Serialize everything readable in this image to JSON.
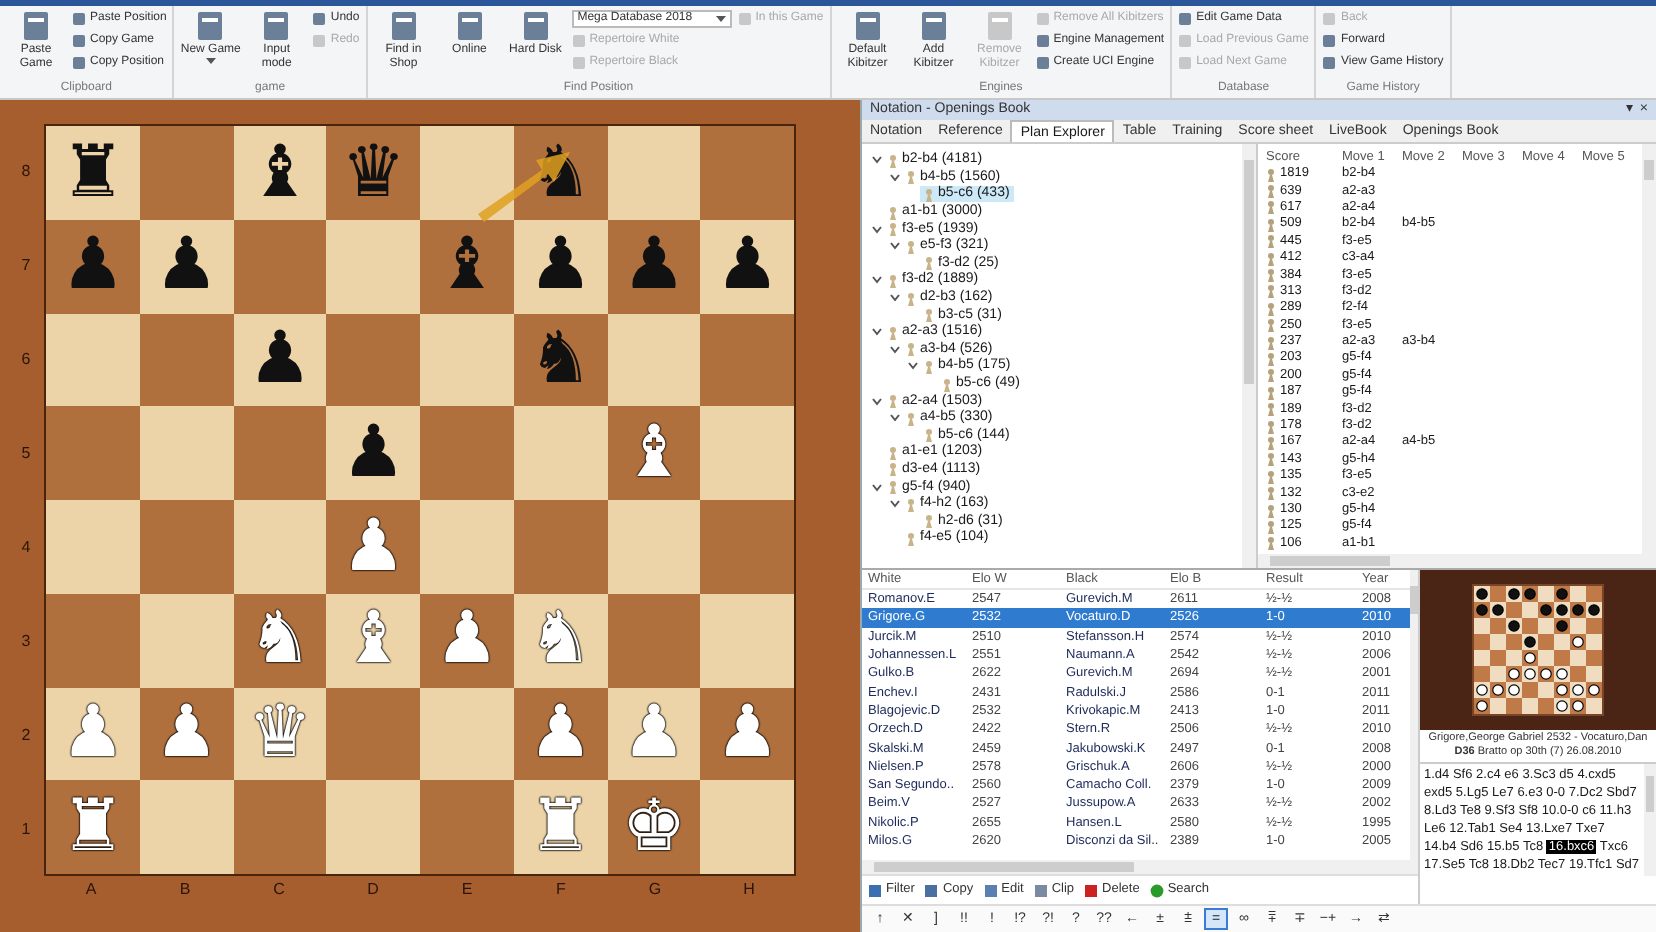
{
  "ribbon": [
    {
      "label": "Clipboard",
      "items": [
        {
          "kind": "large",
          "label": "Paste Game",
          "disabled": false
        },
        {
          "kind": "small",
          "label": "Paste Position",
          "disabled": false
        },
        {
          "kind": "small",
          "label": "Copy Game",
          "disabled": false
        },
        {
          "kind": "small",
          "label": "Copy Position",
          "disabled": false
        }
      ]
    },
    {
      "label": "game",
      "items": [
        {
          "kind": "large",
          "label": "New Game",
          "disabled": false,
          "has_menu": true
        },
        {
          "kind": "large",
          "label": "Input mode",
          "disabled": false
        },
        {
          "kind": "small",
          "label": "Undo",
          "disabled": false
        },
        {
          "kind": "small",
          "label": "Redo",
          "disabled": true
        }
      ]
    },
    {
      "label": "Find Position",
      "items": [
        {
          "kind": "large",
          "label": "Find in Shop",
          "disabled": false
        },
        {
          "kind": "large",
          "label": "Online",
          "disabled": false
        },
        {
          "kind": "large",
          "label": "Hard Disk",
          "disabled": false
        },
        {
          "kind": "dropdown",
          "label": "Mega Database 2018",
          "disabled": false
        },
        {
          "kind": "small",
          "label": "Repertoire White",
          "disabled": true
        },
        {
          "kind": "small",
          "label": "Repertoire Black",
          "disabled": true
        },
        {
          "kind": "small",
          "label": "In this Game",
          "disabled": true
        }
      ]
    },
    {
      "label": "Engines",
      "items": [
        {
          "kind": "large",
          "label": "Default Kibitzer",
          "disabled": false
        },
        {
          "kind": "large",
          "label": "Add Kibitzer",
          "disabled": false
        },
        {
          "kind": "large",
          "label": "Remove Kibitzer",
          "disabled": true
        },
        {
          "kind": "small",
          "label": "Remove All Kibitzers",
          "disabled": true
        },
        {
          "kind": "small",
          "label": "Engine Management",
          "disabled": false
        },
        {
          "kind": "small",
          "label": "Create UCI Engine",
          "disabled": false
        }
      ]
    },
    {
      "label": "Database",
      "items": [
        {
          "kind": "small",
          "label": "Edit Game Data",
          "disabled": false
        },
        {
          "kind": "small",
          "label": "Load Previous Game",
          "disabled": true
        },
        {
          "kind": "small",
          "label": "Load Next Game",
          "disabled": true
        }
      ]
    },
    {
      "label": "Game History",
      "items": [
        {
          "kind": "small",
          "label": "Back",
          "disabled": true
        },
        {
          "kind": "small",
          "label": "Forward",
          "disabled": false
        },
        {
          "kind": "small",
          "label": "View Game History",
          "disabled": false
        }
      ]
    }
  ],
  "board": {
    "rank_labels": [
      "8",
      "7",
      "6",
      "5",
      "4",
      "3",
      "2",
      "1"
    ],
    "file_labels": [
      "A",
      "B",
      "C",
      "D",
      "E",
      "F",
      "G",
      "H"
    ],
    "rows": [
      [
        {
          "glyph": "♜",
          "white": false
        },
        null,
        {
          "glyph": "♝",
          "white": false
        },
        {
          "glyph": "♛",
          "white": false
        },
        null,
        {
          "glyph": "♞",
          "white": false
        },
        null,
        null
      ],
      [
        {
          "glyph": "♟",
          "white": false
        },
        {
          "glyph": "♟",
          "white": false
        },
        null,
        null,
        {
          "glyph": "♝",
          "white": false
        },
        {
          "glyph": "♟",
          "white": false
        },
        {
          "glyph": "♟",
          "white": false
        },
        {
          "glyph": "♟",
          "white": false
        }
      ],
      [
        null,
        null,
        {
          "glyph": "♟",
          "white": false
        },
        null,
        null,
        {
          "glyph": "♞",
          "white": false
        },
        null,
        null
      ],
      [
        null,
        null,
        null,
        {
          "glyph": "♟",
          "white": false
        },
        null,
        null,
        {
          "glyph": "♝",
          "white": true
        },
        null
      ],
      [
        null,
        null,
        null,
        {
          "glyph": "♟",
          "white": true
        },
        null,
        null,
        null,
        null
      ],
      [
        null,
        null,
        {
          "glyph": "♞",
          "white": true
        },
        {
          "glyph": "♝",
          "white": true
        },
        {
          "glyph": "♟",
          "white": true
        },
        {
          "glyph": "♞",
          "white": true
        },
        null,
        null
      ],
      [
        {
          "glyph": "♟",
          "white": true
        },
        {
          "glyph": "♟",
          "white": true
        },
        {
          "glyph": "♛",
          "white": true
        },
        null,
        null,
        {
          "glyph": "♟",
          "white": true
        },
        {
          "glyph": "♟",
          "white": true
        },
        {
          "glyph": "♟",
          "white": true
        }
      ],
      [
        {
          "glyph": "♜",
          "white": true
        },
        null,
        null,
        null,
        null,
        {
          "glyph": "♜",
          "white": true
        },
        {
          "glyph": "♚",
          "white": true
        },
        null
      ]
    ]
  },
  "panel": {
    "title": "Notation - Openings Book",
    "controls": [
      "▾",
      "×"
    ]
  },
  "tabs": [
    {
      "label": "Notation",
      "selected": false
    },
    {
      "label": "Reference",
      "selected": false
    },
    {
      "label": "Plan Explorer",
      "selected": true
    },
    {
      "label": "Table",
      "selected": false
    },
    {
      "label": "Training",
      "selected": false
    },
    {
      "label": "Score sheet",
      "selected": false
    },
    {
      "label": "LiveBook",
      "selected": false
    },
    {
      "label": "Openings Book",
      "selected": false
    }
  ],
  "tree": [
    {
      "label": "b2-b4 (4181)",
      "selected": false,
      "expanded": true,
      "children": [
        {
          "label": "b4-b5 (1560)",
          "selected": false,
          "expanded": true,
          "children": [
            {
              "label": "b5-c6 (433)",
              "selected": true
            }
          ]
        }
      ]
    },
    {
      "label": "a1-b1 (3000)",
      "selected": false
    },
    {
      "label": "f3-e5 (1939)",
      "selected": false,
      "expanded": true,
      "children": [
        {
          "label": "e5-f3 (321)",
          "selected": false,
          "expanded": true,
          "children": [
            {
              "label": "f3-d2 (25)",
              "selected": false
            }
          ]
        }
      ]
    },
    {
      "label": "f3-d2 (1889)",
      "selected": false,
      "expanded": true,
      "children": [
        {
          "label": "d2-b3 (162)",
          "selected": false,
          "expanded": true,
          "children": [
            {
              "label": "b3-c5 (31)",
              "selected": false
            }
          ]
        }
      ]
    },
    {
      "label": "a2-a3 (1516)",
      "selected": false,
      "expanded": true,
      "children": [
        {
          "label": "a3-b4 (526)",
          "selected": false,
          "expanded": true,
          "children": [
            {
              "label": "b4-b5 (175)",
              "selected": false,
              "expanded": true,
              "children": [
                {
                  "label": "b5-c6 (49)",
                  "selected": false
                }
              ]
            }
          ]
        }
      ]
    },
    {
      "label": "a2-a4 (1503)",
      "selected": false,
      "expanded": true,
      "children": [
        {
          "label": "a4-b5 (330)",
          "selected": false,
          "expanded": true,
          "children": [
            {
              "label": "b5-c6 (144)",
              "selected": false
            }
          ]
        }
      ]
    },
    {
      "label": "a1-e1 (1203)",
      "selected": false
    },
    {
      "label": "d3-e4 (1113)",
      "selected": false
    },
    {
      "label": "g5-f4 (940)",
      "selected": false,
      "expanded": true,
      "children": [
        {
          "label": "f4-h2 (163)",
          "selected": false,
          "expanded": true,
          "children": [
            {
              "label": "h2-d6 (31)",
              "selected": false
            }
          ]
        },
        {
          "label": "f4-e5 (104)",
          "selected": false
        }
      ]
    }
  ],
  "score_table": {
    "columns": [
      "Score",
      "Move 1",
      "Move 2",
      "Move 3",
      "Move 4",
      "Move 5"
    ],
    "rows": [
      [
        "1819",
        "b2-b4"
      ],
      [
        "639",
        "a2-a3"
      ],
      [
        "617",
        "a2-a4"
      ],
      [
        "509",
        "b2-b4",
        "b4-b5"
      ],
      [
        "445",
        "f3-e5"
      ],
      [
        "412",
        "c3-a4"
      ],
      [
        "384",
        "f3-e5"
      ],
      [
        "313",
        "f3-d2"
      ],
      [
        "289",
        "f2-f4"
      ],
      [
        "250",
        "f3-e5"
      ],
      [
        "237",
        "a2-a3",
        "a3-b4"
      ],
      [
        "203",
        "g5-f4"
      ],
      [
        "200",
        "g5-f4"
      ],
      [
        "187",
        "g5-f4"
      ],
      [
        "189",
        "f3-d2"
      ],
      [
        "178",
        "f3-d2"
      ],
      [
        "167",
        "a2-a4",
        "a4-b5"
      ],
      [
        "143",
        "g5-h4"
      ],
      [
        "135",
        "f3-e5"
      ],
      [
        "132",
        "c3-e2"
      ],
      [
        "130",
        "g5-h4"
      ],
      [
        "125",
        "g5-f4"
      ],
      [
        "106",
        "a1-b1"
      ]
    ]
  },
  "games": {
    "columns": [
      "White",
      "Elo W",
      "Black",
      "Elo B",
      "Result",
      "Year"
    ],
    "rows": [
      {
        "cells": [
          "Romanov.E",
          "2547",
          "Gurevich.M",
          "2611",
          "½-½",
          "2008"
        ],
        "selected": false
      },
      {
        "cells": [
          "Grigore.G",
          "2532",
          "Vocaturo.D",
          "2526",
          "1-0",
          "2010"
        ],
        "selected": true
      },
      {
        "cells": [
          "Jurcik.M",
          "2510",
          "Stefansson.H",
          "2574",
          "½-½",
          "2010"
        ],
        "selected": false
      },
      {
        "cells": [
          "Johannessen.L",
          "2551",
          "Naumann.A",
          "2542",
          "½-½",
          "2006"
        ],
        "selected": false
      },
      {
        "cells": [
          "Gulko.B",
          "2622",
          "Gurevich.M",
          "2694",
          "½-½",
          "2001"
        ],
        "selected": false
      },
      {
        "cells": [
          "Enchev.I",
          "2431",
          "Radulski.J",
          "2586",
          "0-1",
          "2011"
        ],
        "selected": false
      },
      {
        "cells": [
          "Blagojevic.D",
          "2532",
          "Krivokapic.M",
          "2413",
          "1-0",
          "2011"
        ],
        "selected": false
      },
      {
        "cells": [
          "Orzech.D",
          "2422",
          "Stern.R",
          "2506",
          "½-½",
          "2010"
        ],
        "selected": false
      },
      {
        "cells": [
          "Skalski.M",
          "2459",
          "Jakubowski.K",
          "2497",
          "0-1",
          "2008"
        ],
        "selected": false
      },
      {
        "cells": [
          "Nielsen.P",
          "2578",
          "Grischuk.A",
          "2606",
          "½-½",
          "2000"
        ],
        "selected": false
      },
      {
        "cells": [
          "San Segundo..",
          "2560",
          "Camacho Coll.",
          "2379",
          "1-0",
          "2009"
        ],
        "selected": false
      },
      {
        "cells": [
          "Beim.V",
          "2527",
          "Jussupow.A",
          "2633",
          "½-½",
          "2002"
        ],
        "selected": false
      },
      {
        "cells": [
          "Nikolic.P",
          "2655",
          "Hansen.L",
          "2580",
          "½-½",
          "1995"
        ],
        "selected": false
      },
      {
        "cells": [
          "Milos.G",
          "2620",
          "Disconzi da Sil..",
          "2389",
          "1-0",
          "2005"
        ],
        "selected": false
      }
    ]
  },
  "games_toolbar": [
    "Filter",
    "Copy",
    "Edit",
    "Clip",
    "Delete",
    "Search"
  ],
  "symbols": [
    {
      "text": "↑",
      "selected": false
    },
    {
      "text": "✕",
      "selected": false
    },
    {
      "text": "]",
      "selected": false
    },
    {
      "text": "!!",
      "selected": false
    },
    {
      "text": "!",
      "selected": false
    },
    {
      "text": "!?",
      "selected": false
    },
    {
      "text": "?!",
      "selected": false
    },
    {
      "text": "?",
      "selected": false
    },
    {
      "text": "??",
      "selected": false
    },
    {
      "text": "←",
      "selected": false
    },
    {
      "text": "±",
      "selected": false
    },
    {
      "text": "⩲",
      "selected": false
    },
    {
      "text": "=",
      "selected": true
    },
    {
      "text": "∞",
      "selected": false
    },
    {
      "text": "⩱",
      "selected": false
    },
    {
      "text": "∓",
      "selected": false
    },
    {
      "text": "−+",
      "selected": false
    },
    {
      "text": "→",
      "selected": false
    },
    {
      "text": "⇄",
      "selected": false
    }
  ],
  "preview": {
    "players": "Grigore,George Gabriel 2532 - Vocaturo,Dan",
    "event": "**D36** Bratto op 30th (7) 26.08.2010",
    "moves": [
      {
        "text": "1.d4",
        "selected": false
      },
      {
        "text": "Sf6",
        "selected": false
      },
      {
        "text": "2.c4",
        "selected": false
      },
      {
        "text": "e6",
        "selected": false
      },
      {
        "text": "3.Sc3",
        "selected": false
      },
      {
        "text": "d5",
        "selected": false
      },
      {
        "text": "4.cxd5",
        "selected": false
      },
      {
        "text": "exd5",
        "selected": false
      },
      {
        "text": "5.Lg5",
        "selected": false
      },
      {
        "text": "Le7",
        "selected": false
      },
      {
        "text": "6.e3",
        "selected": false
      },
      {
        "text": "0-0",
        "selected": false
      },
      {
        "text": "7.Dc2",
        "selected": false
      },
      {
        "text": "Sbd7",
        "selected": false
      },
      {
        "text": "8.Ld3",
        "selected": false
      },
      {
        "text": "Te8",
        "selected": false
      },
      {
        "text": "9.Sf3",
        "selected": false
      },
      {
        "text": "Sf8",
        "selected": false
      },
      {
        "text": "10.0-0",
        "selected": false
      },
      {
        "text": "c6",
        "selected": false
      },
      {
        "text": "11.h3",
        "selected": false
      },
      {
        "text": "Le6",
        "selected": false
      },
      {
        "text": "12.Tab1",
        "selected": false
      },
      {
        "text": "Se4",
        "selected": false
      },
      {
        "text": "13.Lxe7",
        "selected": false
      },
      {
        "text": "Txe7",
        "selected": false
      },
      {
        "text": "14.b4",
        "selected": false
      },
      {
        "text": "Sd6",
        "selected": false
      },
      {
        "text": "15.b5",
        "selected": false
      },
      {
        "text": "Tc8",
        "selected": false
      },
      {
        "text": "16.bxc6",
        "selected": true
      },
      {
        "text": "Txc6",
        "selected": false
      },
      {
        "text": "17.Se5",
        "selected": false
      },
      {
        "text": "Tc8",
        "selected": false
      },
      {
        "text": "18.Db2",
        "selected": false
      },
      {
        "text": "Tec7",
        "selected": false
      },
      {
        "text": "19.Tfc1",
        "selected": false
      },
      {
        "text": "Sd7",
        "selected": false
      }
    ]
  }
}
